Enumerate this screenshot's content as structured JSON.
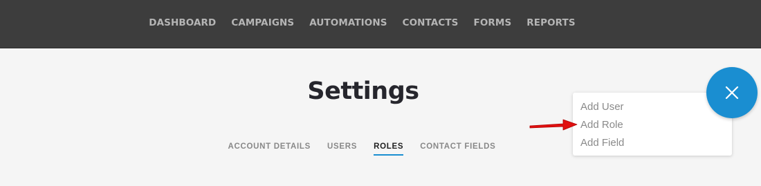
{
  "nav": {
    "items": [
      {
        "label": "DASHBOARD"
      },
      {
        "label": "CAMPAIGNS"
      },
      {
        "label": "AUTOMATIONS"
      },
      {
        "label": "CONTACTS"
      },
      {
        "label": "FORMS"
      },
      {
        "label": "REPORTS"
      }
    ]
  },
  "page": {
    "title": "Settings"
  },
  "tabs": [
    {
      "label": "ACCOUNT DETAILS",
      "active": false
    },
    {
      "label": "USERS",
      "active": false
    },
    {
      "label": "ROLES",
      "active": true
    },
    {
      "label": "CONTACT FIELDS",
      "active": false
    }
  ],
  "fab_menu": {
    "items": [
      {
        "label": "Add User"
      },
      {
        "label": "Add Role"
      },
      {
        "label": "Add Field"
      }
    ],
    "close_icon": "close-icon"
  },
  "colors": {
    "topbar": "#3d3d3d",
    "accent": "#1a8ed1",
    "annotation_arrow": "#e01010"
  }
}
